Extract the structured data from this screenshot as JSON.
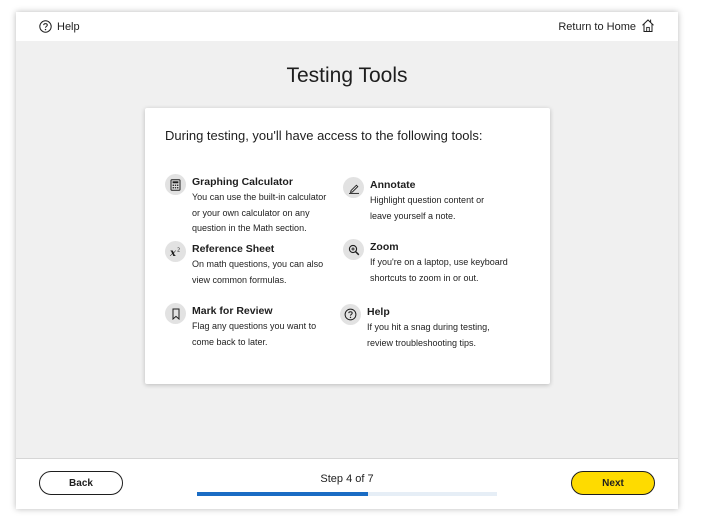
{
  "header": {
    "help_label": "Help",
    "return_home_label": "Return to Home"
  },
  "page": {
    "title": "Testing Tools"
  },
  "card": {
    "heading": "During testing, you'll have access to the following tools:",
    "tools": [
      {
        "name": "Graphing Calculator",
        "icon": "calculator-icon",
        "lines": [
          "You can use the built-in calculator",
          "or your own calculator on any",
          "question in the Math section."
        ]
      },
      {
        "name": "Annotate",
        "icon": "annotate-pen-icon",
        "lines": [
          "Highlight question content or",
          "leave yourself a note."
        ]
      },
      {
        "name": "Reference Sheet",
        "icon": "formula-icon",
        "lines": [
          "On math questions, you can also",
          "view common formulas."
        ]
      },
      {
        "name": "Zoom",
        "icon": "zoom-in-icon",
        "lines": [
          "If you're on a laptop, use keyboard",
          "shortcuts to zoom in or out."
        ]
      },
      {
        "name": "Mark for Review",
        "icon": "bookmark-icon",
        "lines": [
          "Flag any questions you want to",
          "come back to later."
        ]
      },
      {
        "name": "Help",
        "icon": "help-circle-icon",
        "lines": [
          "If you hit a snag during testing,",
          "review troubleshooting tips."
        ]
      }
    ]
  },
  "footer": {
    "back_label": "Back",
    "next_label": "Next",
    "step_text": "Step 4 of 7",
    "progress_fraction": 0.571
  },
  "colors": {
    "next_button": "#fedb00",
    "progress_fill": "#1a6cc4",
    "progress_track": "#e6eef6",
    "page_background": "#f0f0f0"
  }
}
